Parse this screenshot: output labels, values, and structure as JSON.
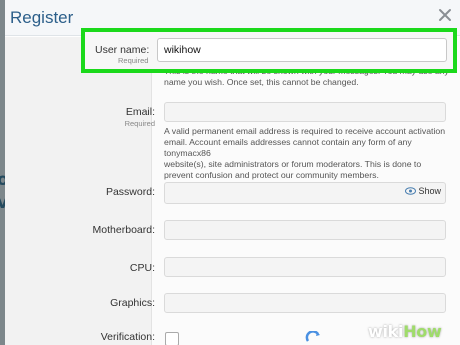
{
  "dialog": {
    "title": "Register",
    "close_icon": "close-icon"
  },
  "username": {
    "label": "User name:",
    "sublabel": "Required",
    "value": "wikihow",
    "hint": "This is the name that will be shown with your messages. You may use any name you wish. Once set, this cannot be changed."
  },
  "email": {
    "label": "Email:",
    "sublabel": "Required",
    "value": "",
    "hint_lines": [
      "A valid permanent email address is required to receive account activation",
      "email. Account emails addresses cannot contain any form of any tonymacx86",
      "website(s), site administrators or forum moderators. This is done to",
      "prevent confusion and protect our community members."
    ]
  },
  "password": {
    "label": "Password:",
    "value": "",
    "show_label": "Show",
    "show_icon": "eye-icon"
  },
  "motherboard": {
    "label": "Motherboard:",
    "value": ""
  },
  "cpu": {
    "label": "CPU:",
    "value": ""
  },
  "graphics": {
    "label": "Graphics:",
    "value": ""
  },
  "verification": {
    "label": "Verification:"
  },
  "watermark": {
    "wiki": "wiki",
    "how": "How"
  },
  "colors": {
    "highlight": "#1bd91b",
    "title": "#2c5f8a"
  }
}
